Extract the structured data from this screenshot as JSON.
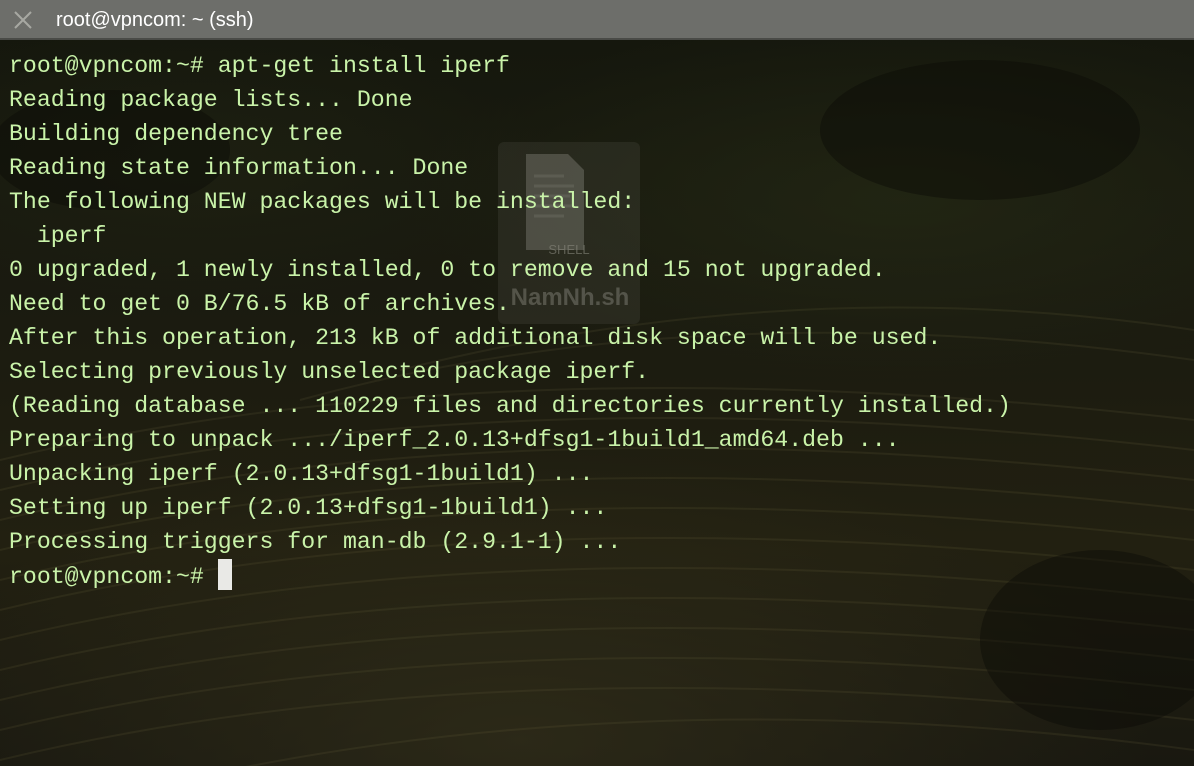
{
  "window": {
    "title": "root@vpncom: ~ (ssh)",
    "close_icon": "close-x-icon"
  },
  "terminal": {
    "lines": [
      "root@vpncom:~# apt-get install iperf",
      "Reading package lists... Done",
      "Building dependency tree",
      "Reading state information... Done",
      "The following NEW packages will be installed:",
      "  iperf",
      "0 upgraded, 1 newly installed, 0 to remove and 15 not upgraded.",
      "Need to get 0 B/76.5 kB of archives.",
      "After this operation, 213 kB of additional disk space will be used.",
      "Selecting previously unselected package iperf.",
      "(Reading database ... 110229 files and directories currently installed.)",
      "Preparing to unpack .../iperf_2.0.13+dfsg1-1build1_amd64.deb ...",
      "Unpacking iperf (2.0.13+dfsg1-1build1) ...",
      "Setting up iperf (2.0.13+dfsg1-1build1) ...",
      "Processing triggers for man-db (2.9.1-1) ..."
    ],
    "prompt": "root@vpncom:~#",
    "text_color": "#c9f3a9",
    "cursor_color": "#e9e9e6"
  },
  "watermark": {
    "icon": "shell-script-icon",
    "label": "SHELL",
    "brand": "NamNh.sh"
  }
}
